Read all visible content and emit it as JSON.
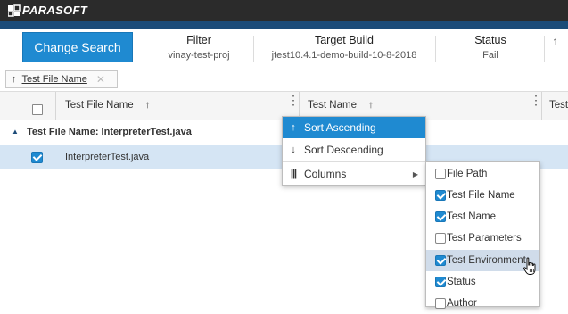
{
  "app": {
    "logo_text": "PARASOFT"
  },
  "header": {
    "change_search_label": "Change Search",
    "columns": [
      {
        "title": "Filter",
        "value": "vinay-test-proj"
      },
      {
        "title": "Target Build",
        "value": "jtest10.4.1-demo-build-10-8-2018"
      },
      {
        "title": "Status",
        "value": "Fail"
      },
      {
        "title": "",
        "value": "1"
      }
    ]
  },
  "sort_chip": {
    "arrow": "↑",
    "label": "Test File Name",
    "close": "✕"
  },
  "grid": {
    "columns": [
      {
        "label": "Test File Name",
        "sort": "↑"
      },
      {
        "label": "Test Name",
        "sort": "↑"
      },
      {
        "label": "Test"
      }
    ],
    "kebab": "⋮",
    "group_label": "Test File Name: InterpreterTest.java",
    "group_toggle": "▲",
    "rows": [
      {
        "test_file_name": "InterpreterTest.java",
        "checked": true
      }
    ]
  },
  "column_menu": {
    "items": [
      {
        "icon": "↑",
        "label": "Sort Ascending",
        "active": true
      },
      {
        "icon": "↓",
        "label": "Sort Descending",
        "active": false
      },
      {
        "icon": "|||",
        "label": "Columns",
        "submenu": "▶"
      }
    ]
  },
  "columns_submenu": {
    "items": [
      {
        "label": "File Path",
        "checked": false
      },
      {
        "label": "Test File Name",
        "checked": true
      },
      {
        "label": "Test Name",
        "checked": true
      },
      {
        "label": "Test Parameters",
        "checked": false
      },
      {
        "label": "Test Environment",
        "checked": true,
        "hover": true
      },
      {
        "label": "Status",
        "checked": true
      },
      {
        "label": "Author",
        "checked": false
      }
    ]
  },
  "colors": {
    "accent": "#1f8ad1",
    "topbar": "#2b2b2b",
    "band": "#1c4b78",
    "row_selected": "#d5e5f4",
    "submenu_hover": "#d0dcea"
  }
}
